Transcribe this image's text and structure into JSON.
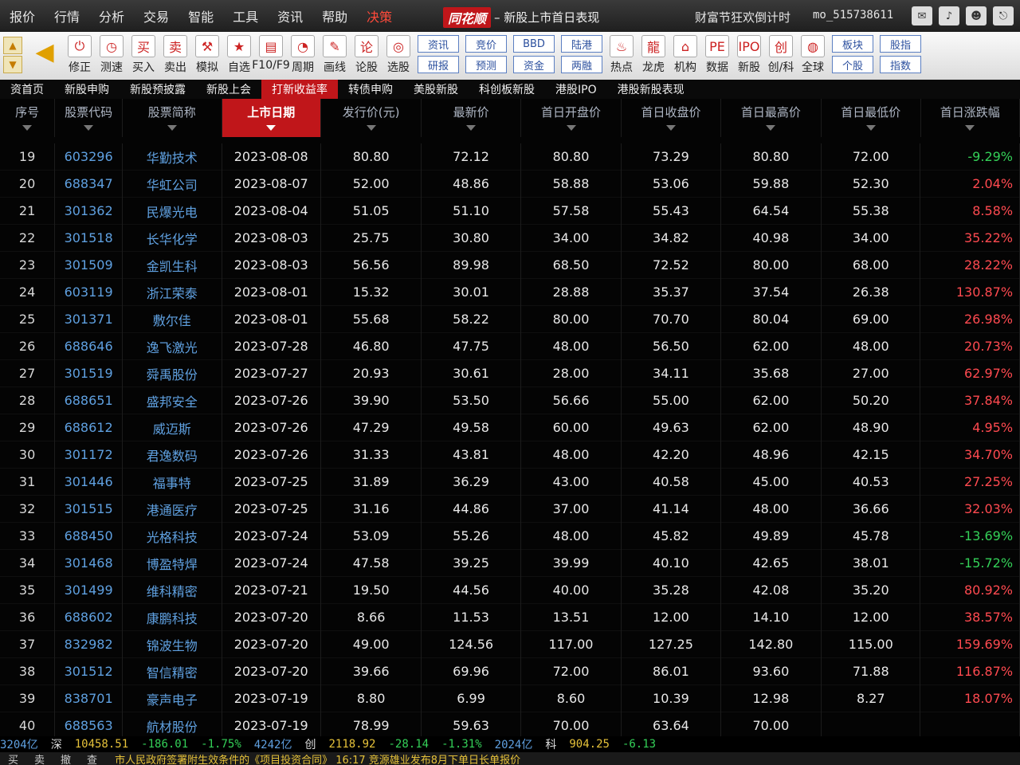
{
  "menubar": {
    "items": [
      "报价",
      "行情",
      "分析",
      "交易",
      "智能",
      "工具",
      "资讯",
      "帮助"
    ],
    "highlight_item": "决策",
    "brand": "同花顺",
    "title": "新股上市首日表现",
    "promo": "财富节狂欢倒计时",
    "username": "mo_515738611"
  },
  "toolbar": {
    "buttons": [
      {
        "label": "修正",
        "icon": "⏻"
      },
      {
        "label": "测速",
        "icon": "◷"
      },
      {
        "label": "买入",
        "icon": "买"
      },
      {
        "label": "卖出",
        "icon": "卖"
      },
      {
        "label": "模拟",
        "icon": "⚒"
      },
      {
        "label": "自选",
        "icon": "★"
      },
      {
        "label": "F10/F9",
        "icon": "▤"
      },
      {
        "label": "周期",
        "icon": "◔"
      },
      {
        "label": "画线",
        "icon": "✎"
      },
      {
        "label": "论股",
        "icon": "论"
      },
      {
        "label": "选股",
        "icon": "◎"
      }
    ],
    "pairs": [
      [
        "资讯",
        "研报"
      ],
      [
        "竞价",
        "预测"
      ],
      [
        "BBD",
        "资金"
      ],
      [
        "陆港",
        "两融"
      ]
    ],
    "buttons2": [
      {
        "label": "热点",
        "icon": "♨"
      },
      {
        "label": "龙虎",
        "icon": "龍"
      },
      {
        "label": "机构",
        "icon": "⌂"
      },
      {
        "label": "数据",
        "icon": "PE"
      },
      {
        "label": "新股",
        "icon": "IPO"
      },
      {
        "label": "创/科",
        "icon": "创"
      },
      {
        "label": "全球",
        "icon": "◍"
      }
    ],
    "pairs2": [
      [
        "板块",
        "个股"
      ],
      [
        "股指",
        "指数"
      ]
    ]
  },
  "tabs": [
    "资首页",
    "新股申购",
    "新股预披露",
    "新股上会",
    "打新收益率",
    "转债申购",
    "美股新股",
    "科创板新股",
    "港股IPO",
    "港股新股表现"
  ],
  "active_tab": "打新收益率",
  "table": {
    "headers": [
      "序号",
      "股票代码",
      "股票简称",
      "上市日期",
      "发行价(元)",
      "最新价",
      "首日开盘价",
      "首日收盘价",
      "首日最高价",
      "首日最低价",
      "首日涨跌幅"
    ],
    "sorted_column": 3,
    "rows": [
      [
        "19",
        "603296",
        "华勤技术",
        "2023-08-08",
        "80.80",
        "72.12",
        "80.80",
        "73.29",
        "80.80",
        "72.00",
        "-9.29%"
      ],
      [
        "20",
        "688347",
        "华虹公司",
        "2023-08-07",
        "52.00",
        "48.86",
        "58.88",
        "53.06",
        "59.88",
        "52.30",
        "2.04%"
      ],
      [
        "21",
        "301362",
        "民爆光电",
        "2023-08-04",
        "51.05",
        "51.10",
        "57.58",
        "55.43",
        "64.54",
        "55.38",
        "8.58%"
      ],
      [
        "22",
        "301518",
        "长华化学",
        "2023-08-03",
        "25.75",
        "30.80",
        "34.00",
        "34.82",
        "40.98",
        "34.00",
        "35.22%"
      ],
      [
        "23",
        "301509",
        "金凯生科",
        "2023-08-03",
        "56.56",
        "89.98",
        "68.50",
        "72.52",
        "80.00",
        "68.00",
        "28.22%"
      ],
      [
        "24",
        "603119",
        "浙江荣泰",
        "2023-08-01",
        "15.32",
        "30.01",
        "28.88",
        "35.37",
        "37.54",
        "26.38",
        "130.87%"
      ],
      [
        "25",
        "301371",
        "敷尔佳",
        "2023-08-01",
        "55.68",
        "58.22",
        "80.00",
        "70.70",
        "80.04",
        "69.00",
        "26.98%"
      ],
      [
        "26",
        "688646",
        "逸飞激光",
        "2023-07-28",
        "46.80",
        "47.75",
        "48.00",
        "56.50",
        "62.00",
        "48.00",
        "20.73%"
      ],
      [
        "27",
        "301519",
        "舜禹股份",
        "2023-07-27",
        "20.93",
        "30.61",
        "28.00",
        "34.11",
        "35.68",
        "27.00",
        "62.97%"
      ],
      [
        "28",
        "688651",
        "盛邦安全",
        "2023-07-26",
        "39.90",
        "53.50",
        "56.66",
        "55.00",
        "62.00",
        "50.20",
        "37.84%"
      ],
      [
        "29",
        "688612",
        "威迈斯",
        "2023-07-26",
        "47.29",
        "49.58",
        "60.00",
        "49.63",
        "62.00",
        "48.90",
        "4.95%"
      ],
      [
        "30",
        "301172",
        "君逸数码",
        "2023-07-26",
        "31.33",
        "43.81",
        "48.00",
        "42.20",
        "48.96",
        "42.15",
        "34.70%"
      ],
      [
        "31",
        "301446",
        "福事特",
        "2023-07-25",
        "31.89",
        "36.29",
        "43.00",
        "40.58",
        "45.00",
        "40.53",
        "27.25%"
      ],
      [
        "32",
        "301515",
        "港通医疗",
        "2023-07-25",
        "31.16",
        "44.86",
        "37.00",
        "41.14",
        "48.00",
        "36.66",
        "32.03%"
      ],
      [
        "33",
        "688450",
        "光格科技",
        "2023-07-24",
        "53.09",
        "55.26",
        "48.00",
        "45.82",
        "49.89",
        "45.78",
        "-13.69%"
      ],
      [
        "34",
        "301468",
        "博盈特焊",
        "2023-07-24",
        "47.58",
        "39.25",
        "39.99",
        "40.10",
        "42.65",
        "38.01",
        "-15.72%"
      ],
      [
        "35",
        "301499",
        "维科精密",
        "2023-07-21",
        "19.50",
        "44.56",
        "40.00",
        "35.28",
        "42.08",
        "35.20",
        "80.92%"
      ],
      [
        "36",
        "688602",
        "康鹏科技",
        "2023-07-20",
        "8.66",
        "11.53",
        "13.51",
        "12.00",
        "14.10",
        "12.00",
        "38.57%"
      ],
      [
        "37",
        "832982",
        "锦波生物",
        "2023-07-20",
        "49.00",
        "124.56",
        "117.00",
        "127.25",
        "142.80",
        "115.00",
        "159.69%"
      ],
      [
        "38",
        "301512",
        "智信精密",
        "2023-07-20",
        "39.66",
        "69.96",
        "72.00",
        "86.01",
        "93.60",
        "71.88",
        "116.87%"
      ],
      [
        "39",
        "838701",
        "豪声电子",
        "2023-07-19",
        "8.80",
        "6.99",
        "8.60",
        "10.39",
        "12.98",
        "8.27",
        "18.07%"
      ],
      [
        "40",
        "688563",
        "航材股份",
        "2023-07-19",
        "78.99",
        "59.63",
        "70.00",
        "63.64",
        "70.00",
        "",
        ""
      ]
    ]
  },
  "statusbar": {
    "items": [
      {
        "text": "3204亿",
        "cls": "s-blue"
      },
      {
        "text": "深",
        "cls": "s-white"
      },
      {
        "text": "10458.51",
        "cls": "s-yellow"
      },
      {
        "text": "-186.01",
        "cls": "s-green"
      },
      {
        "text": "-1.75%",
        "cls": "s-green"
      },
      {
        "text": "4242亿",
        "cls": "s-blue"
      },
      {
        "text": "创",
        "cls": "s-white"
      },
      {
        "text": "2118.92",
        "cls": "s-yellow"
      },
      {
        "text": "-28.14",
        "cls": "s-green"
      },
      {
        "text": "-1.31%",
        "cls": "s-green"
      },
      {
        "text": "2024亿",
        "cls": "s-blue"
      },
      {
        "text": "科",
        "cls": "s-white"
      },
      {
        "text": "904.25",
        "cls": "s-yellow"
      },
      {
        "text": "-6.13",
        "cls": "s-green"
      }
    ]
  },
  "bottombar": {
    "buttons": [
      "买",
      "卖",
      "撤",
      "查"
    ],
    "ticker": "市人民政府签署附生效条件的《项目投资合同》      16:17 竞源雄业发布8月下单日长单报价"
  }
}
